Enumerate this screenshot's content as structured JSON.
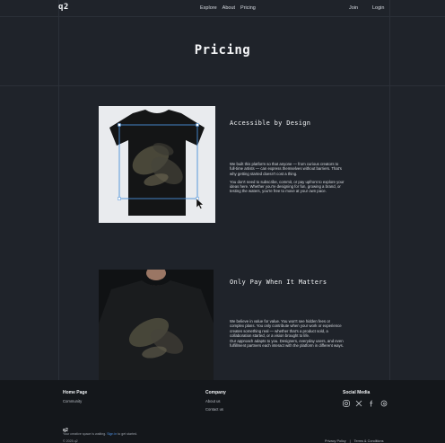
{
  "header": {
    "logo": "q2",
    "nav": [
      "Explore",
      "About",
      "Pricing"
    ],
    "join": "Join",
    "login": "Login"
  },
  "page_title": "Pricing",
  "sections": [
    {
      "title": "Accessible by Design",
      "paragraphs": [
        "We built this platform so that anyone — from curious creators to full-time artists — can express themselves without barriers. That's why getting started doesn't cost a thing.",
        "You don't need to subscribe, commit, or pay upfront to explore your ideas here. Whether you're designing for fun, growing a brand, or testing the waters, you're free to move at your own pace."
      ]
    },
    {
      "title": "Only Pay When It Matters",
      "paragraphs": [
        "We believe in value for value. You won't see hidden fees or complex plans. You only contribute when your work or experience creates something real — whether that's a product sold, a collaboration started, or a vision brought to life.",
        "Our approach adapts to you. Designers, everyday users, and even fulfillment partners each interact with the platform in different ways."
      ]
    }
  ],
  "footer": {
    "col1_title": "Home Page",
    "col1_links": [
      "Community"
    ],
    "col2_title": "Company",
    "col2_links": [
      "About us",
      "Contact us"
    ],
    "col3_title": "Social Media",
    "social_icons": [
      "instagram-icon",
      "x-icon",
      "facebook-icon",
      "threads-icon"
    ],
    "logo": "q2",
    "tagline_pre": "Your creative space is waiting.",
    "tagline_link": "Sign in",
    "tagline_post": "to get started.",
    "copyright": "© 2025 q2",
    "privacy": "Privacy Policy",
    "separator": "|",
    "terms": "Terms & Conditions"
  },
  "colors": {
    "background": "#1f232a",
    "footer": "#14171b",
    "selection": "#4a90d9",
    "link": "#4d8fe0"
  }
}
